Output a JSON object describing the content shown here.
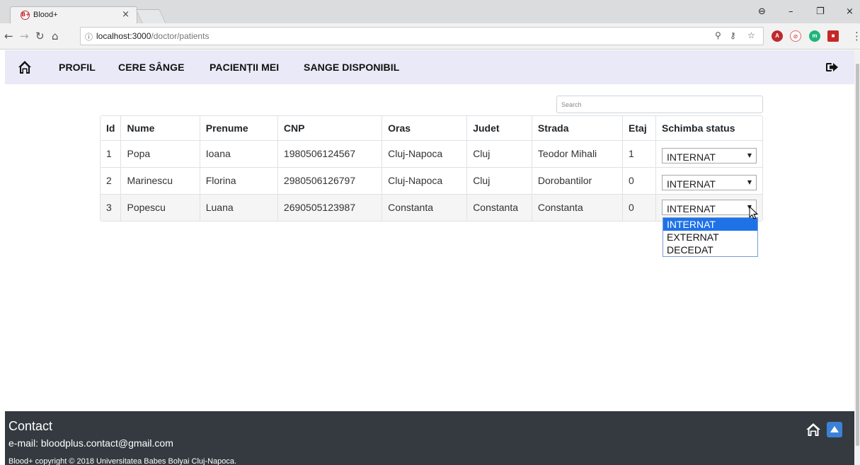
{
  "browser": {
    "tab_title": "Blood+",
    "tab_favicon": "B+",
    "tab_close": "×",
    "url_host": "localhost:3000",
    "url_path": "/doctor/patients",
    "info_icon": "ⓘ",
    "controls": {
      "minimize": "–",
      "restore": "❐",
      "close": "×",
      "account": "⊖"
    }
  },
  "navbar": {
    "links": [
      {
        "label": "PROFIL"
      },
      {
        "label": "CERE SÂNGE"
      },
      {
        "label": "PACIENȚII MEI"
      },
      {
        "label": "SANGE DISPONIBIL"
      }
    ]
  },
  "search": {
    "placeholder": "Search"
  },
  "table": {
    "headers": [
      "Id",
      "Nume",
      "Prenume",
      "CNP",
      "Oras",
      "Judet",
      "Strada",
      "Etaj",
      "Schimba status"
    ],
    "rows": [
      {
        "id": "1",
        "nume": "Popa",
        "prenume": "Ioana",
        "cnp": "1980506124567",
        "oras": "Cluj-Napoca",
        "judet": "Cluj",
        "strada": "Teodor Mihali",
        "etaj": "1",
        "status": "INTERNAT"
      },
      {
        "id": "2",
        "nume": "Marinescu",
        "prenume": "Florina",
        "cnp": "2980506126797",
        "oras": "Cluj-Napoca",
        "judet": "Cluj",
        "strada": "Dorobantilor",
        "etaj": "0",
        "status": "INTERNAT"
      },
      {
        "id": "3",
        "nume": "Popescu",
        "prenume": "Luana",
        "cnp": "2690505123987",
        "oras": "Constanta",
        "judet": "Constanta",
        "strada": "Constanta",
        "etaj": "0",
        "status": "INTERNAT"
      }
    ]
  },
  "status_dropdown": {
    "options": [
      "INTERNAT",
      "EXTERNAT",
      "DECEDAT"
    ],
    "highlighted": "INTERNAT"
  },
  "footer": {
    "title": "Contact",
    "email": "e-mail: bloodplus.contact@gmail.com",
    "copyright": "Blood+ copyright © 2018 Universitatea Babes Bolyai Cluj-Napoca."
  },
  "colors": {
    "navbar_bg": "#e9e9f7",
    "footer_bg": "#343a40",
    "highlight": "#1e72e8",
    "brand_red": "#c0282e"
  }
}
